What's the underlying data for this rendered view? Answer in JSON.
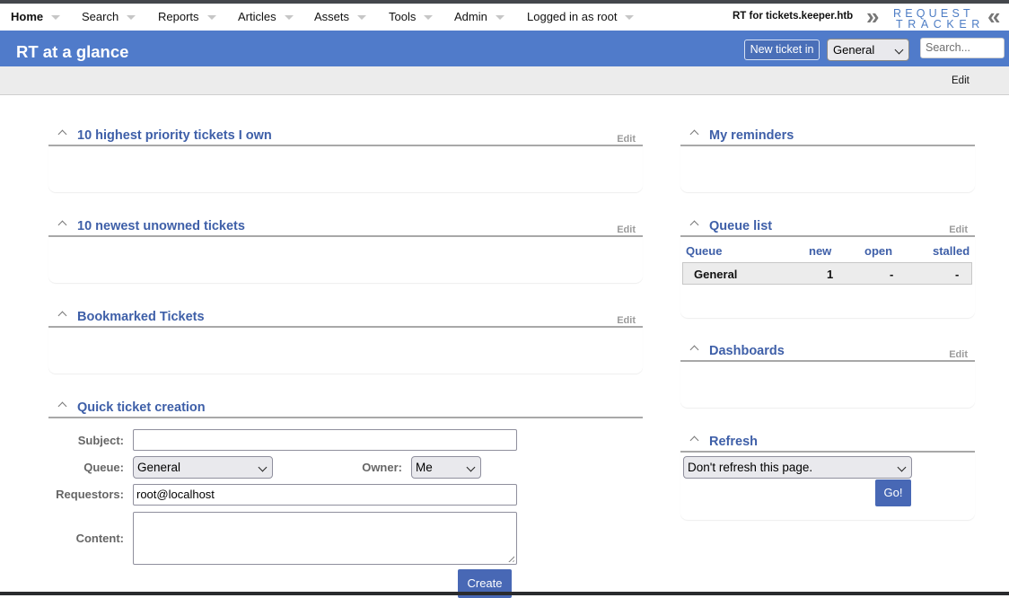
{
  "nav": {
    "items": [
      {
        "label": "Home",
        "active": true
      },
      {
        "label": "Search"
      },
      {
        "label": "Reports"
      },
      {
        "label": "Articles"
      },
      {
        "label": "Assets"
      },
      {
        "label": "Tools"
      },
      {
        "label": "Admin"
      },
      {
        "label": "Logged in as root"
      }
    ],
    "site_name": "RT for tickets.keeper.htb",
    "logo": {
      "line1": "REQUEST",
      "line2": "TRACKER",
      "chevron_left": "»",
      "chevron_right": "«"
    }
  },
  "header": {
    "title": "RT at a glance",
    "new_ticket_label": "New ticket in",
    "queue_select_value": "General",
    "search_placeholder": "Search..."
  },
  "page_menu": {
    "edit_label": "Edit"
  },
  "colors": {
    "brand_blue": "#507bca",
    "portlet_title": "#3e5fa8",
    "button_blue": "#4868b5"
  },
  "left": {
    "portlets": [
      {
        "title": "10 highest priority tickets I own",
        "edit": "Edit"
      },
      {
        "title": "10 newest unowned tickets",
        "edit": "Edit"
      },
      {
        "title": "Bookmarked Tickets",
        "edit": "Edit"
      },
      {
        "title": "Quick ticket creation"
      }
    ],
    "quick_create": {
      "subject_label": "Subject:",
      "subject_value": "",
      "queue_label": "Queue:",
      "queue_value": "General",
      "owner_label": "Owner:",
      "owner_value": "Me",
      "requestors_label": "Requestors:",
      "requestors_value": "root@localhost",
      "content_label": "Content:",
      "content_value": "",
      "create_label": "Create"
    }
  },
  "right": {
    "reminders": {
      "title": "My reminders"
    },
    "queue_list": {
      "title": "Queue list",
      "edit": "Edit",
      "columns": [
        "Queue",
        "new",
        "open",
        "stalled"
      ],
      "rows": [
        {
          "queue": "General",
          "new": "1",
          "open": "-",
          "stalled": "-"
        }
      ]
    },
    "dashboards": {
      "title": "Dashboards",
      "edit": "Edit"
    },
    "refresh": {
      "title": "Refresh",
      "select_value": "Don't refresh this page.",
      "go_label": "Go!"
    }
  }
}
